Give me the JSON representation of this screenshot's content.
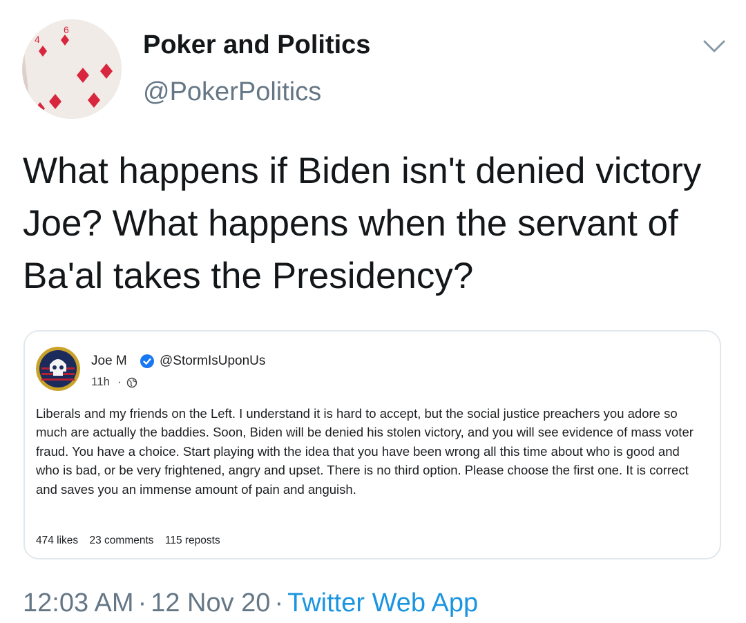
{
  "author": {
    "display_name": "Poker and Politics",
    "handle": "@PokerPolitics"
  },
  "tweet": {
    "text": "What happens if Biden isn't denied victory Joe? What happens when the servant of Ba'al takes the Presidency?"
  },
  "quoted_post": {
    "name": "Joe M",
    "verified": true,
    "handle": "@StormIsUponUs",
    "time": "11h",
    "separator": "·",
    "audience_icon": "globe-icon",
    "body": "Liberals and my friends on the Left. I understand it is hard to accept, but the social justice preachers you adore so much are actually the baddies. Soon, Biden will be denied his stolen victory, and you will see evidence of mass voter fraud. You have a choice. Start playing with the idea that you have been wrong all this time about who is good and who is bad, or be very frightened, angry and upset. There is no third option. Please choose the first one. It is correct and saves you an immense amount of pain and anguish.",
    "likes": "474 likes",
    "comments": "23 comments",
    "reposts": "115 reposts"
  },
  "meta": {
    "time": "12:03 AM",
    "date": "12 Nov 20",
    "separator": "·",
    "source": "Twitter Web App"
  },
  "colors": {
    "secondary_text": "#657786",
    "link": "#1b95e0",
    "verified": "#1877f2",
    "card_border": "#e1e8ed"
  },
  "icons": {
    "menu": "chevron-down-icon",
    "avatar": "playing-card-avatar",
    "quoted_avatar": "skull-flag-avatar",
    "verified": "verified-badge-icon"
  }
}
